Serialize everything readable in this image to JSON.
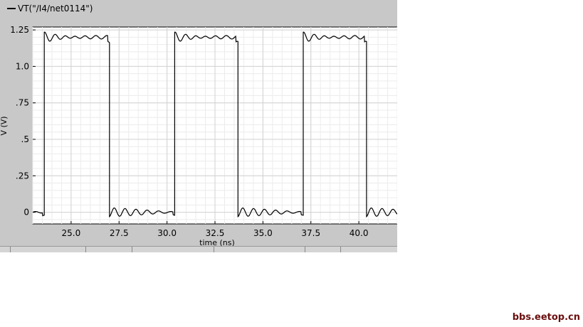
{
  "chart_data": {
    "type": "line",
    "legend": "VT(\"/I4/net0114\")",
    "xlabel": "time (ns)",
    "ylabel": "V (V)",
    "xlim": [
      23.0,
      42.0
    ],
    "ylim": [
      -0.08,
      1.27
    ],
    "x_ticks": [
      25.0,
      27.5,
      30.0,
      32.5,
      35.0,
      37.5,
      40.0
    ],
    "x_tick_labels": [
      "25.0",
      "27.5",
      "30.0",
      "32.5",
      "35.0",
      "37.5",
      "40.0"
    ],
    "y_ticks": [
      0,
      0.25,
      0.5,
      0.75,
      1.0,
      1.25
    ],
    "y_tick_labels": [
      "0",
      ".25",
      ".5",
      ".75",
      "1.0",
      "1.25"
    ],
    "grid": true,
    "series": [
      {
        "name": "VT(\"/I4/net0114\")",
        "color": "#000000",
        "transitions_ns": [
          23.6,
          27.0,
          30.4,
          33.7,
          37.1,
          40.4
        ],
        "high_level": 1.2,
        "low_level": 0.0,
        "start_level": 0.0,
        "end_time_ns": 42.0
      }
    ]
  },
  "watermark": "bbs.eetop.cn"
}
